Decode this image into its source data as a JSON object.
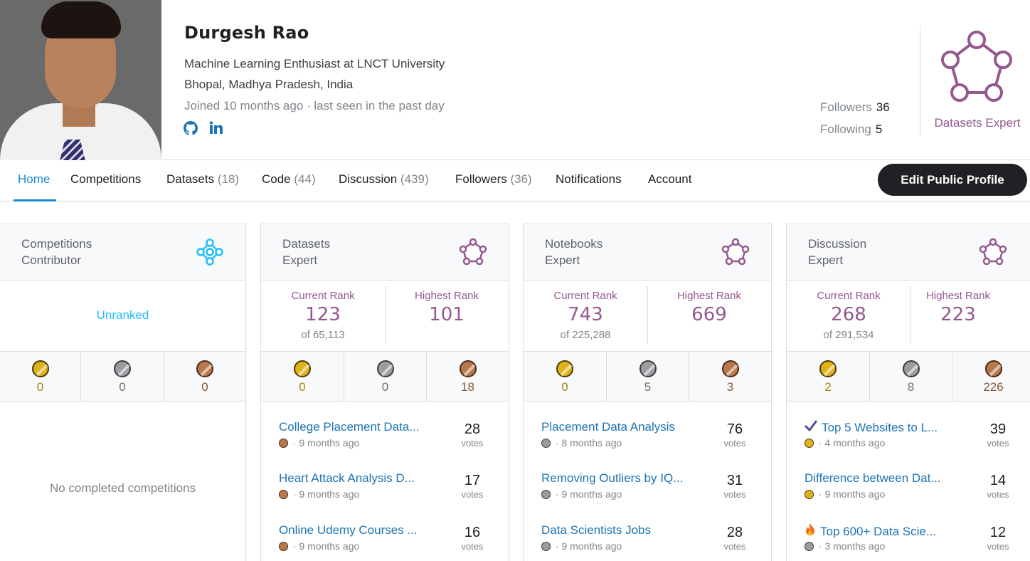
{
  "profile": {
    "name": "Durgesh Rao",
    "occupation": "Machine Learning Enthusiast at LNCT University",
    "location": "Bhopal, Madhya Pradesh, India",
    "joined": "Joined 10 months ago · last seen in the past day",
    "followers_label": "Followers",
    "followers_count": "36",
    "following_label": "Following",
    "following_count": "5",
    "tier": "Datasets Expert",
    "social_icons": [
      "github-icon",
      "linkedin-icon"
    ]
  },
  "nav": {
    "tabs": [
      {
        "label": "Home",
        "count": ""
      },
      {
        "label": "Competitions",
        "count": ""
      },
      {
        "label": "Datasets",
        "count": "(18)"
      },
      {
        "label": "Code",
        "count": "(44)"
      },
      {
        "label": "Discussion",
        "count": "(439)"
      },
      {
        "label": "Followers",
        "count": "(36)"
      },
      {
        "label": "Notifications",
        "count": ""
      },
      {
        "label": "Account",
        "count": ""
      }
    ],
    "active": "Home",
    "edit_button": "Edit Public Profile"
  },
  "cards": [
    {
      "title_line1": "Competitions",
      "title_line2": "Contributor",
      "unranked": "Unranked",
      "medals": {
        "gold": "0",
        "silver": "0",
        "bronze": "0"
      },
      "empty": "No completed competitions",
      "icon": "contributor-tier-icon",
      "color": "#20beff"
    },
    {
      "title_line1": "Datasets",
      "title_line2": "Expert",
      "current_rank_label": "Current Rank",
      "current_rank": "123",
      "of": "of 65,113",
      "highest_rank_label": "Highest Rank",
      "highest_rank": "101",
      "medals": {
        "gold": "0",
        "silver": "0",
        "bronze": "18"
      },
      "items": [
        {
          "title": "College Placement Data...",
          "medal": "bronze",
          "meta": " · 9 months ago",
          "votes": "28"
        },
        {
          "title": "Heart Attack Analysis D...",
          "medal": "bronze",
          "meta": " · 9 months ago",
          "votes": "17"
        },
        {
          "title": "Online Udemy Courses ...",
          "medal": "bronze",
          "meta": " · 9 months ago",
          "votes": "16"
        }
      ]
    },
    {
      "title_line1": "Notebooks",
      "title_line2": "Expert",
      "current_rank_label": "Current Rank",
      "current_rank": "743",
      "of": "of 225,288",
      "highest_rank_label": "Highest Rank",
      "highest_rank": "669",
      "medals": {
        "gold": "0",
        "silver": "5",
        "bronze": "3"
      },
      "items": [
        {
          "title": "Placement Data Analysis",
          "medal": "silver",
          "meta": " · 8 months ago",
          "votes": "76"
        },
        {
          "title": "Removing Outliers by IQ...",
          "medal": "silver",
          "meta": " · 9 months ago",
          "votes": "31"
        },
        {
          "title": "Data Scientists Jobs",
          "medal": "silver",
          "meta": " · 9 months ago",
          "votes": "28"
        }
      ]
    },
    {
      "title_line1": "Discussion",
      "title_line2": "Expert",
      "current_rank_label": "Current Rank",
      "current_rank": "268",
      "of": "of 291,534",
      "highest_rank_label": "Highest Rank",
      "highest_rank": "223",
      "medals": {
        "gold": "2",
        "silver": "8",
        "bronze": "226"
      },
      "items": [
        {
          "title": "Top 5 Websites to L...",
          "prefix_icon": "checkmark-icon",
          "medal": "gold",
          "meta": " · 4 months ago",
          "votes": "39"
        },
        {
          "title": "Difference between Dat...",
          "medal": "gold",
          "meta": " · 9 months ago",
          "votes": "14"
        },
        {
          "title": "Top 600+ Data Scie...",
          "prefix_icon": "fire-icon",
          "medal": "silver",
          "meta": " · 3 months ago",
          "votes": "12"
        }
      ]
    }
  ],
  "votes_label": "votes",
  "colors": {
    "expert": "#95588f",
    "contributor": "#20beff",
    "link": "#1b74b4",
    "active_tab": "#1a8ad4"
  }
}
